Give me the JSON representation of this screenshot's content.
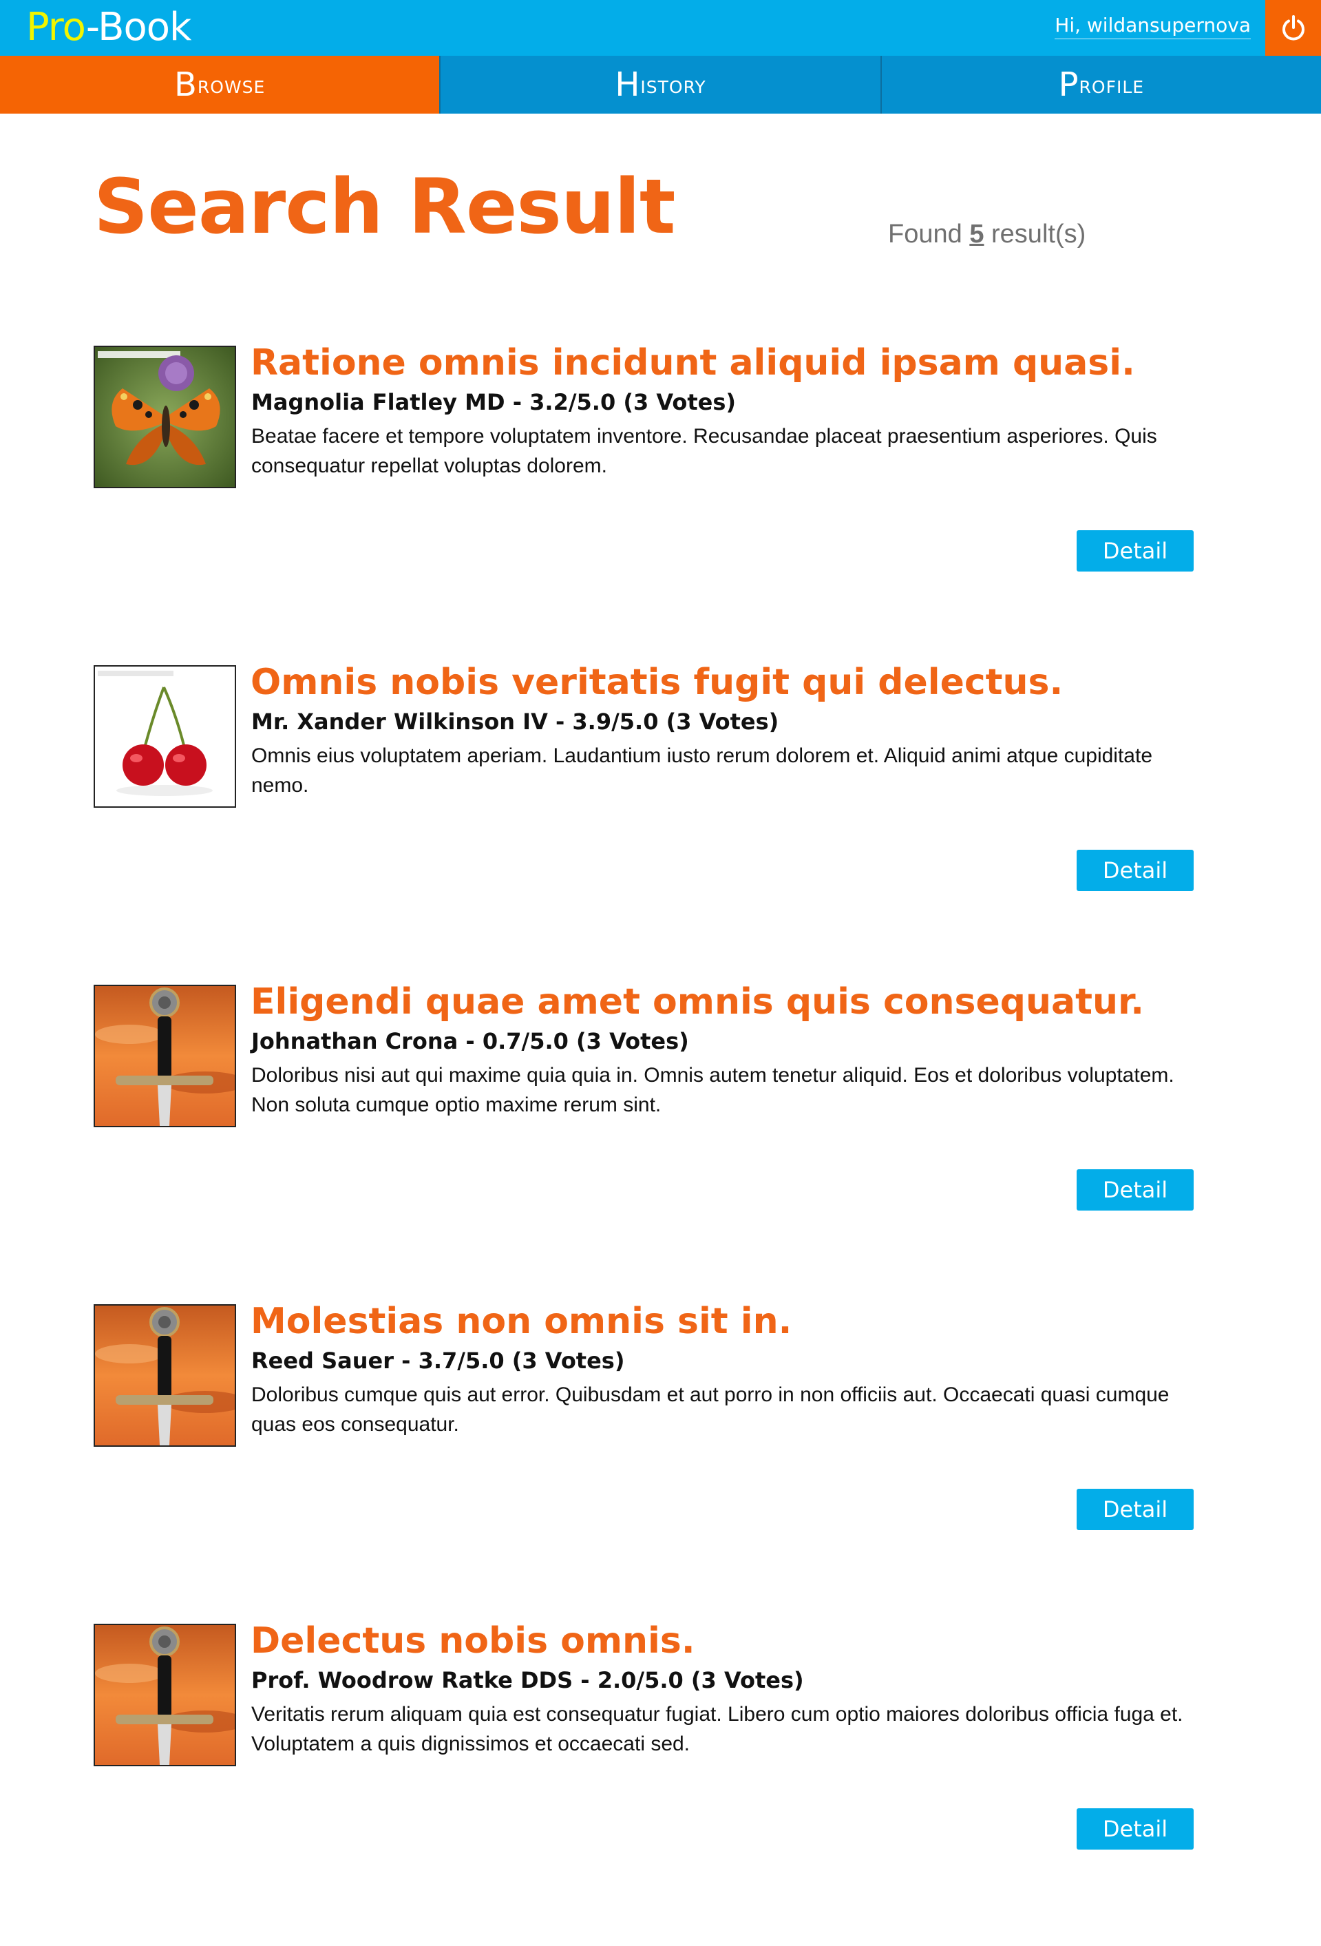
{
  "header": {
    "logo_pro": "Pro",
    "logo_rest": "-Book",
    "greeting": "Hi, wildansupernova",
    "logout_icon": "power-icon",
    "colors": {
      "topbar": "#03ade9",
      "accent": "#f56404",
      "logo_pro": "#f2f500"
    }
  },
  "nav": {
    "tabs": [
      {
        "first": "B",
        "rest": "rowse",
        "active": true
      },
      {
        "first": "H",
        "rest": "istory",
        "active": false
      },
      {
        "first": "P",
        "rest": "rofile",
        "active": false
      }
    ]
  },
  "page": {
    "title": "Search Result",
    "found_prefix": "Found",
    "found_count": "5",
    "found_suffix": "result(s)"
  },
  "results": [
    {
      "title": "Ratione omnis incidunt aliquid ipsam quasi.",
      "meta": "Magnolia Flatley MD - 3.2/5.0 (3 Votes)",
      "description": "Beatae facere et tempore voluptatem inventore. Recusandae placeat praesentium asperiores. Quis consequatur repellat voluptas dolorem.",
      "cover": "butterfly-image",
      "button": "Detail"
    },
    {
      "title": "Omnis nobis veritatis fugit qui delectus.",
      "meta": "Mr. Xander Wilkinson IV - 3.9/5.0 (3 Votes)",
      "description": "Omnis eius voluptatem aperiam. Laudantium iusto rerum dolorem et. Aliquid animi atque cupiditate nemo.",
      "cover": "cherries-image",
      "button": "Detail"
    },
    {
      "title": "Eligendi quae amet omnis quis consequatur.",
      "meta": "Johnathan Crona - 0.7/5.0 (3 Votes)",
      "description": "Doloribus nisi aut qui maxime quia quia in. Omnis autem tenetur aliquid. Eos et doloribus voluptatem. Non soluta cumque optio maxime rerum sint.",
      "cover": "sword-image",
      "button": "Detail"
    },
    {
      "title": "Molestias non omnis sit in.",
      "meta": "Reed Sauer - 3.7/5.0 (3 Votes)",
      "description": "Doloribus cumque quis aut error. Quibusdam et aut porro in non officiis aut. Occaecati quasi cumque quas eos consequatur.",
      "cover": "sword-image",
      "button": "Detail"
    },
    {
      "title": "Delectus nobis omnis.",
      "meta": "Prof. Woodrow Ratke DDS - 2.0/5.0 (3 Votes)",
      "description": "Veritatis rerum aliquam quia est consequatur fugiat. Libero cum optio maiores doloribus officia fuga et. Voluptatem a quis dignissimos et occaecati sed.",
      "cover": "sword-image",
      "button": "Detail"
    }
  ]
}
